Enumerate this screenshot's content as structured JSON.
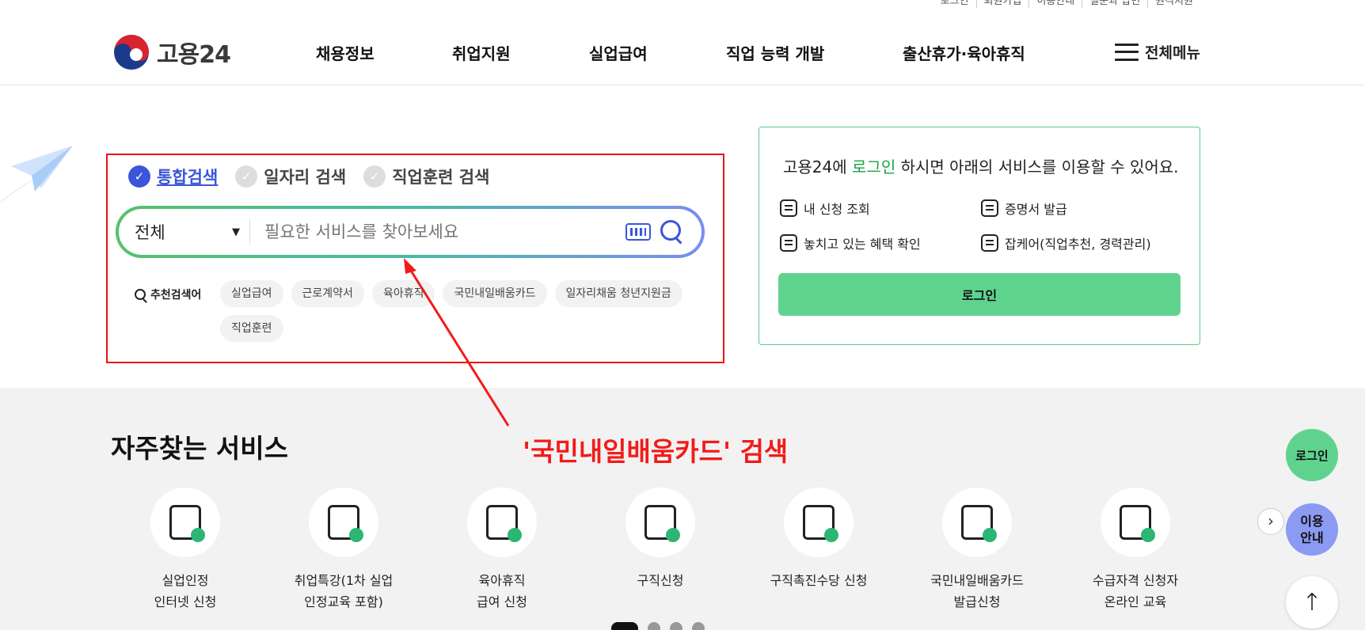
{
  "util_links": [
    "로그인",
    "회원가입",
    "이용안내",
    "질문과 답변",
    "원격지원"
  ],
  "logo": {
    "text": "고용24"
  },
  "gnb": [
    {
      "label": "채용정보"
    },
    {
      "label": "취업지원"
    },
    {
      "label": "실업급여"
    },
    {
      "label": "직업 능력 개발"
    },
    {
      "label": "출산휴가·육아휴직"
    }
  ],
  "all_menu": {
    "label": "전체메뉴"
  },
  "search": {
    "tabs": [
      {
        "label": "통합검색",
        "active": true
      },
      {
        "label": "일자리 검색",
        "active": false
      },
      {
        "label": "직업훈련 검색",
        "active": false
      }
    ],
    "scope_selected": "전체",
    "placeholder": "필요한 서비스를 찾아보세요",
    "recommended_label": "추천검색어",
    "recommended": [
      "실업급여",
      "근로계약서",
      "육아휴직",
      "국민내일배움카드",
      "일자리채움 청년지원금",
      "직업훈련"
    ]
  },
  "login_panel": {
    "title_pre": "고용24에 ",
    "title_hl": "로그인",
    "title_post": " 하시면 아래의 서비스를 이용할 수 있어요.",
    "items": [
      "내 신청 조회",
      "증명서 발급",
      "놓치고 있는 혜택 확인",
      "잡케어(직업추천, 경력관리)"
    ],
    "button": "로그인"
  },
  "annotation": {
    "text": "'국민내일배움카드' 검색",
    "color": "#f21b1b"
  },
  "frequent": {
    "title": "자주찾는 서비스",
    "services": [
      {
        "line1": "실업인정",
        "line2": "인터넷 신청",
        "icon": "document-pen-icon"
      },
      {
        "line1": "취업특강(1차 실업",
        "line2": "인정교육 포함)",
        "icon": "presentation-board-icon"
      },
      {
        "line1": "육아휴직",
        "line2": "급여 신청",
        "icon": "baby-bottle-icon"
      },
      {
        "line1": "구직신청",
        "line2": "",
        "icon": "person-pen-icon"
      },
      {
        "line1": "구직촉진수당 신청",
        "line2": "",
        "icon": "money-bag-icon"
      },
      {
        "line1": "국민내일배움카드",
        "line2": "발급신청",
        "icon": "card-icon"
      },
      {
        "line1": "수급자격 신청자",
        "line2": "온라인 교육",
        "icon": "monitor-play-icon"
      }
    ]
  },
  "fabs": {
    "login": "로그인",
    "guide_1": "이용",
    "guide_2": "안내",
    "top": "↑"
  },
  "colors": {
    "brand_green": "#5fd38e",
    "brand_blue": "#3b56d9",
    "annotation_red": "#f21b1b"
  }
}
